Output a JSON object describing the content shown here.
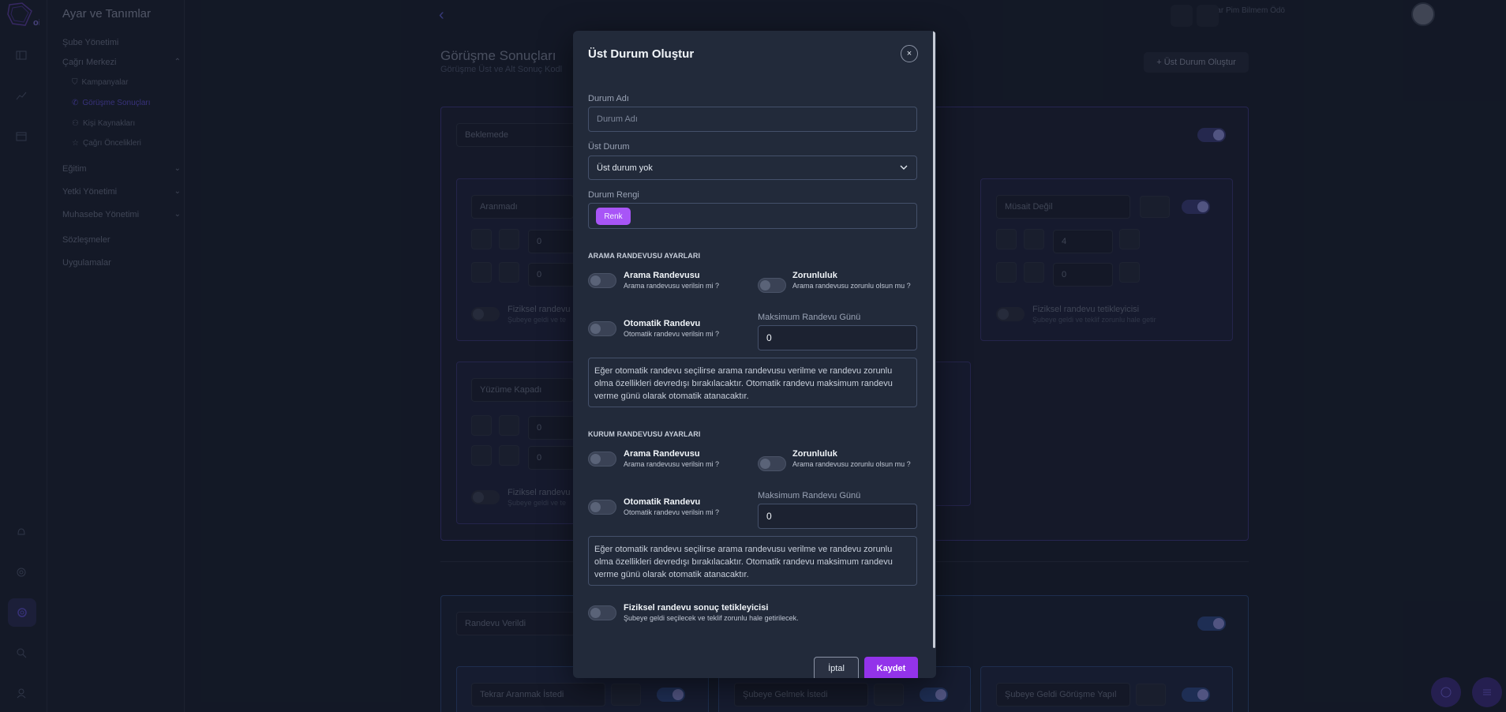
{
  "app": {
    "menu_title": "Ayar ve Tanımlar",
    "menu_items": [
      {
        "label": "Şube Yönetimi"
      },
      {
        "label": "Çağrı Merkezi"
      },
      {
        "label": "Eğitim"
      },
      {
        "label": "Yetki Yönetimi"
      },
      {
        "label": "Muhasebe Yönetimi"
      },
      {
        "label": "Sözleşmeler"
      },
      {
        "label": "Uygulamalar"
      }
    ],
    "sub_items": [
      {
        "label": "Kampanyalar"
      },
      {
        "label": "Görüşme Sonuçları"
      },
      {
        "label": "Kişi Kaynakları"
      },
      {
        "label": "Çağrı Öncelikleri"
      }
    ],
    "top_right_text": "Bağlılar Pim Bilmem Ödö",
    "page_title": "Görüşme Sonuçları",
    "page_subtitle": "Görüşme Üst ve Alt Sonuç Kodl",
    "create_button": "+ Üst Durum Oluştur",
    "group1_name": "Beklemede",
    "group2_name": "Randevu Verildi",
    "cards": {
      "c1": "Aranmadı",
      "c2": "Müsait Değil",
      "c3": "Yüzüme Kapadı",
      "c4": "Tekrar Aranmak İstedi",
      "c5": "Şubeye Gelmek İstedi",
      "c6": "Şubeye Geldi Görüşme Yapıl"
    },
    "card_values": {
      "v0": "0",
      "v4": "4"
    },
    "card_trigger_title": "Fiziksel randevu tetikleyicisi",
    "card_trigger_short": "Fiziksel randevu",
    "card_trigger_desc": "Şubeye geldi ve teklif zorunlu hale getir",
    "card_trigger_desc_short": "Şubeye geldi ve te"
  },
  "modal": {
    "title": "Üst Durum Oluştur",
    "close": "×",
    "name_label": "Durum Adı",
    "name_placeholder": "Durum Adı",
    "parent_label": "Üst Durum",
    "parent_value": "Üst durum yok",
    "color_label": "Durum Rengi",
    "color_chip": "Renk",
    "accent_color": "#a855f7",
    "call_section": {
      "title": "ARAMA RANDEVUSU AYARLARI",
      "appointment_title": "Arama Randevusu",
      "appointment_desc": "Arama randevusu verilsin mi ?",
      "required_title": "Zorunluluk",
      "required_desc": "Arama randevusu zorunlu olsun mu ?",
      "auto_title": "Otomatik Randevu",
      "auto_desc": "Otomatik randevu verilsin mi ?",
      "max_label": "Maksimum Randevu Günü",
      "max_value": "0",
      "info": "Eğer otomatik randevu seçilirse arama randevusu verilme ve randevu zorunlu olma özellikleri devredışı bırakılacaktır. Otomatik randevu maksimum randevu verme günü olarak otomatik atanacaktır."
    },
    "institution_section": {
      "title": "KURUM RANDEVUSU AYARLARI",
      "appointment_title": "Arama Randevusu",
      "appointment_desc": "Arama randevusu verilsin mi ?",
      "required_title": "Zorunluluk",
      "required_desc": "Arama randevusu zorunlu olsun mu ?",
      "auto_title": "Otomatik Randevu",
      "auto_desc": "Otomatik randevu verilsin mi ?",
      "max_label": "Maksimum Randevu Günü",
      "max_value": "0",
      "info": "Eğer otomatik randevu seçilirse arama randevusu verilme ve randevu zorunlu olma özellikleri devredışı bırakılacaktır. Otomatik randevu maksimum randevu verme günü olarak otomatik atanacaktır."
    },
    "physical_title": "Fiziksel randevu sonuç tetikleyicisi",
    "physical_desc": "Şubeye geldi seçilecek ve teklif zorunlu hale getirilecek.",
    "cancel": "İptal",
    "save": "Kaydet"
  }
}
